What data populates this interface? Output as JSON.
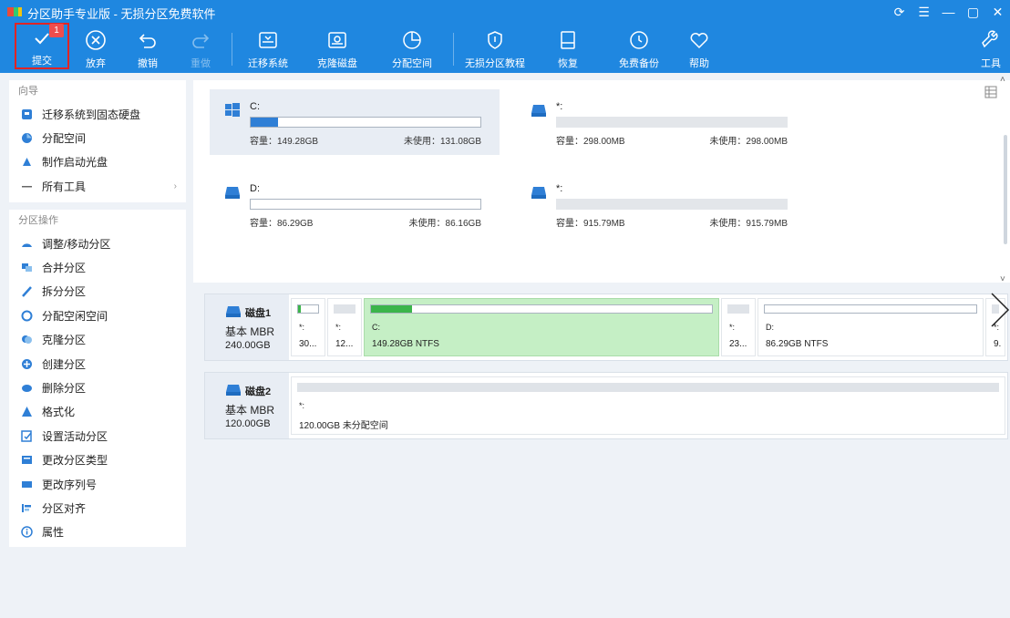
{
  "app": {
    "title": "分区助手专业版 - 无损分区免费软件"
  },
  "window_controls": [
    "⟳",
    "☰",
    "—",
    "▢",
    "✕"
  ],
  "toolbar": [
    {
      "id": "apply",
      "label": "提交",
      "badge": "1",
      "icon": "check-icon",
      "enabled": true
    },
    {
      "id": "discard",
      "label": "放弃",
      "icon": "cancel-icon",
      "enabled": true
    },
    {
      "id": "undo",
      "label": "撤销",
      "icon": "undo-icon",
      "enabled": true
    },
    {
      "id": "redo",
      "label": "重做",
      "icon": "redo-icon",
      "enabled": false
    },
    {
      "id": "migrate",
      "label": "迁移系统",
      "icon": "migrate-disk-icon",
      "enabled": true
    },
    {
      "id": "clone",
      "label": "克隆磁盘",
      "icon": "clone-disk-icon",
      "enabled": true
    },
    {
      "id": "alloc",
      "label": "分配空间",
      "icon": "allocate-space-icon",
      "enabled": true
    },
    {
      "id": "wipe",
      "label": "无损分区教程",
      "icon": "shield-icon",
      "enabled": true
    },
    {
      "id": "restore",
      "label": "恢复",
      "icon": "restore-icon",
      "enabled": true
    },
    {
      "id": "backup",
      "label": "免费备份",
      "icon": "backup-icon",
      "enabled": true
    },
    {
      "id": "help",
      "label": "帮助",
      "icon": "heart-icon",
      "enabled": true
    },
    {
      "id": "tools",
      "label": "工具",
      "icon": "wrench-icon",
      "enabled": true
    }
  ],
  "sidebar": {
    "wizard_title": "向导",
    "wizard_items": [
      {
        "label": "迁移系统到固态硬盘",
        "icon": "migrate-icon"
      },
      {
        "label": "分配空间",
        "icon": "allocate-icon"
      },
      {
        "label": "制作启动光盘",
        "icon": "boot-disk-icon"
      },
      {
        "label": "所有工具",
        "icon": "all-tools-icon",
        "has_arrow": true
      }
    ],
    "ops_title": "分区操作",
    "ops_items": [
      {
        "label": "调整/移动分区",
        "icon": "resize-icon"
      },
      {
        "label": "合并分区",
        "icon": "merge-icon"
      },
      {
        "label": "拆分分区",
        "icon": "split-icon"
      },
      {
        "label": "分配空闲空间",
        "icon": "pie-icon"
      },
      {
        "label": "克隆分区",
        "icon": "clone-icon"
      },
      {
        "label": "创建分区",
        "icon": "create-icon"
      },
      {
        "label": "删除分区",
        "icon": "delete-icon"
      },
      {
        "label": "格式化",
        "icon": "format-icon"
      },
      {
        "label": "设置活动分区",
        "icon": "active-icon"
      },
      {
        "label": "更改分区类型",
        "icon": "type-icon"
      },
      {
        "label": "更改序列号",
        "icon": "serial-icon"
      },
      {
        "label": "分区对齐",
        "icon": "align-icon"
      },
      {
        "label": "属性",
        "icon": "info-icon"
      }
    ]
  },
  "partition_cards": [
    {
      "name": "C:",
      "fill": 0.12,
      "capacity": "容量：149.28GB",
      "free": "未使用：131.08GB",
      "selected": true,
      "icon": "windows-icon"
    },
    {
      "name": "*:",
      "fill": 0,
      "capacity": "容量：298.00MB",
      "free": "未使用：298.00MB",
      "selected": false,
      "icon": "drive-icon"
    },
    {
      "name": "D:",
      "fill": 0,
      "capacity": "容量：86.29GB",
      "free": "未使用：86.16GB",
      "selected": false,
      "icon": "drive-icon"
    },
    {
      "name": "*:",
      "fill": 0,
      "capacity": "容量：915.79MB",
      "free": "未使用：915.79MB",
      "selected": false,
      "icon": "drive-icon"
    }
  ],
  "disks": [
    {
      "name": "磁盘1",
      "type": "基本 MBR",
      "size": "240.00GB",
      "partitions": [
        {
          "name": "*:",
          "info": "30...",
          "fill": 0.15,
          "bar": "white"
        },
        {
          "name": "*:",
          "info": "12...",
          "fill": 0,
          "bar": "grey"
        },
        {
          "name": "C:",
          "info": "149.28GB NTFS",
          "fill": 0.12,
          "bar": "white",
          "selected": true
        },
        {
          "name": "*:",
          "info": "23...",
          "fill": 0,
          "bar": "grey"
        },
        {
          "name": "D:",
          "info": "86.29GB NTFS",
          "fill": 0,
          "bar": "white"
        },
        {
          "name": "*:",
          "info": "9.",
          "fill": 0,
          "bar": "grey"
        }
      ]
    },
    {
      "name": "磁盘2",
      "type": "基本 MBR",
      "size": "120.00GB",
      "partitions": [
        {
          "name": "*:",
          "info": "120.00GB 未分配空间",
          "fill": 0,
          "bar": "grey"
        }
      ]
    }
  ],
  "colors": {
    "accent": "#1f87e0",
    "selected_partition": "#c5efc5",
    "used_bar": "#2f7fd6",
    "used_bar_green": "#3bb54a"
  }
}
